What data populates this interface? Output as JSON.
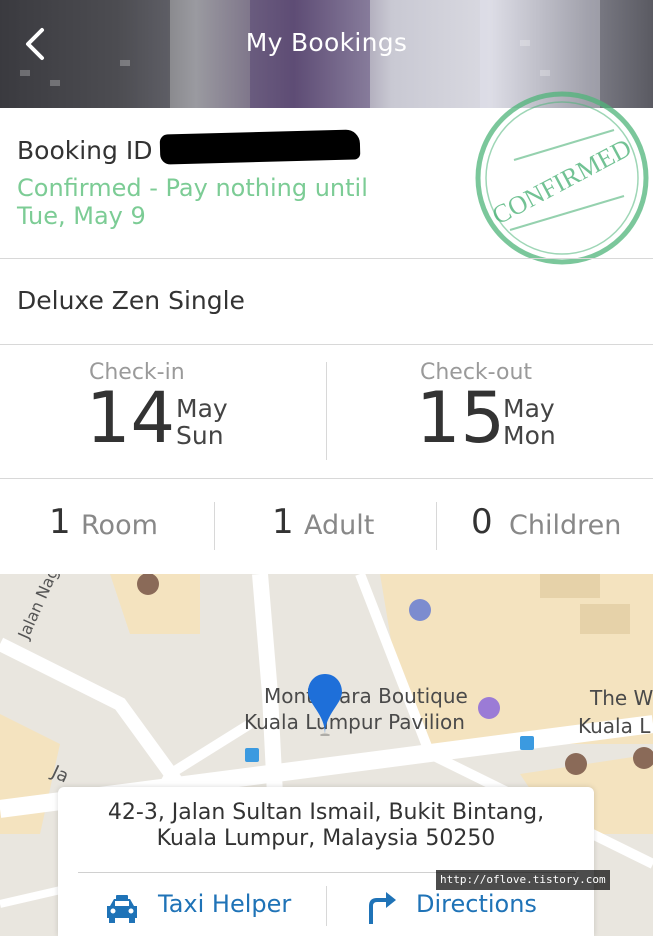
{
  "header": {
    "title": "My Bookings"
  },
  "booking": {
    "id_label": "Booking ID",
    "status_line1": "Confirmed - Pay nothing until",
    "status_line2": "Tue, May 9",
    "stamp_text": "CONFIRMED"
  },
  "room_type": "Deluxe Zen Single",
  "checkin": {
    "label": "Check-in",
    "day": "14",
    "month": "May",
    "weekday": "Sun"
  },
  "checkout": {
    "label": "Check-out",
    "day": "15",
    "month": "May",
    "weekday": "Mon"
  },
  "guests": [
    {
      "count": "1",
      "unit": "Room"
    },
    {
      "count": "1",
      "unit": "Adult"
    },
    {
      "count": "0",
      "unit": "Children"
    }
  ],
  "map": {
    "street_label": "Jalan Nagasari",
    "place_line1": "Mont Kiara Boutique",
    "place_line2": "Kuala Lumpur Pavilion",
    "right_label1": "The W",
    "right_label2": "Kuala L",
    "partial_label": "Ja"
  },
  "address": {
    "line1": "42-3, Jalan Sultan Ismail, Bukit Bintang,",
    "line2": "Kuala Lumpur, Malaysia 50250"
  },
  "actions": {
    "taxi": "Taxi Helper",
    "directions": "Directions"
  },
  "watermark": "http://oflove.tistory.com",
  "colors": {
    "accent_green": "#7ccc95",
    "link_blue": "#1f73b7",
    "pin_blue": "#1e6fd9"
  }
}
